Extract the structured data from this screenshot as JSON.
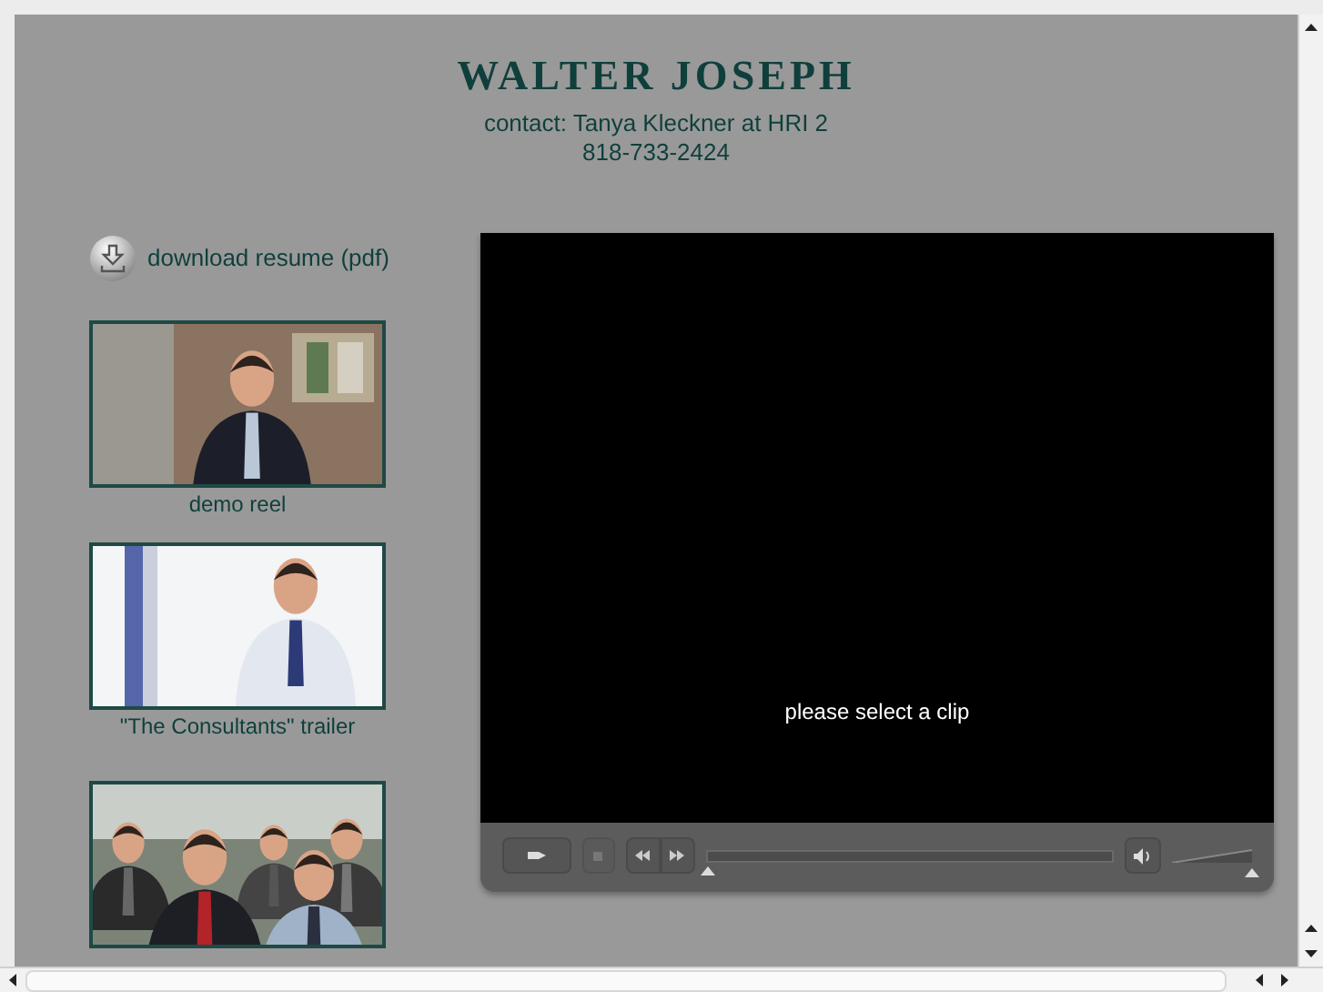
{
  "header": {
    "name": "WALTER JOSEPH",
    "contact": "contact: Tanya Kleckner at HRI 2",
    "phone": "818-733-2424"
  },
  "download_link": "download resume (pdf)",
  "clips": [
    {
      "kind": "picture",
      "caption": "demo reel"
    },
    {
      "kind": "picture",
      "caption": "\"The Consultants\" trailer"
    },
    {
      "kind": "picture"
    }
  ],
  "player": {
    "message": "please select a clip",
    "progress": {
      "level": 0
    },
    "volume": {
      "level": 1
    }
  }
}
